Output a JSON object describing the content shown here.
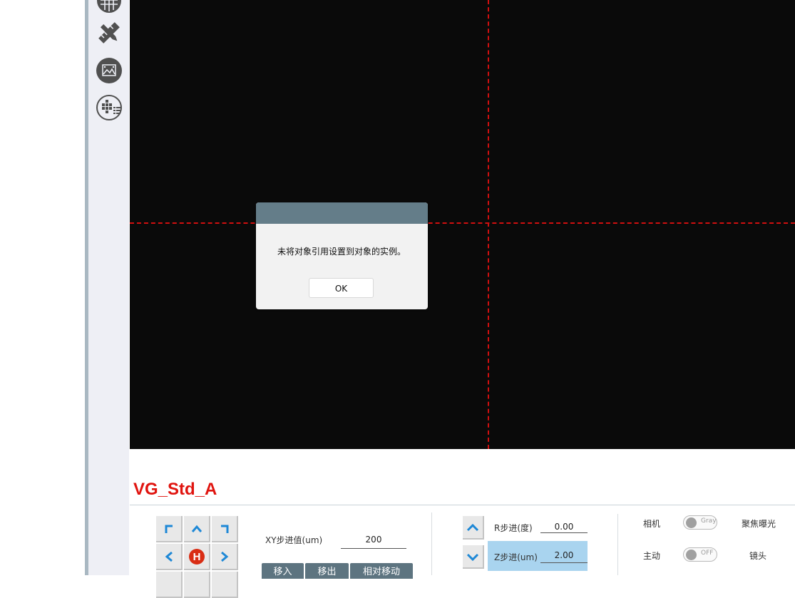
{
  "dialog": {
    "message": "未将对象引用设置到对象的实例。",
    "ok_label": "OK"
  },
  "recipe": {
    "name": "VG_Std_A"
  },
  "xy_panel": {
    "step_label": "XY步进值(um)",
    "step_value": "200",
    "buttons": [
      "移入",
      "移出",
      "相对移动"
    ],
    "home_label": "H"
  },
  "z_panel": {
    "r_step_label": "R步进(度)",
    "r_step_value": "0.00",
    "z_step_label": "Z步进(um)",
    "z_step_value": "2.00"
  },
  "camera_panel": {
    "camera_label": "相机",
    "camera_toggle": "Gray",
    "focus_label": "聚焦曝光",
    "active_label": "主动",
    "active_toggle": "OFF",
    "lens_label": "镜头"
  },
  "colors": {
    "recipe_name": "#e0140f",
    "crosshair": "#d10f0f",
    "dialog_title": "#647d89",
    "z_step_highlight": "#a9d4ef",
    "jog_arrow": "#1e88d6",
    "home_button": "#d92d14"
  },
  "icons": [
    "wafer-grid-icon",
    "ruler-pencil-icon",
    "image-frame-icon",
    "wafer-map-list-icon"
  ]
}
